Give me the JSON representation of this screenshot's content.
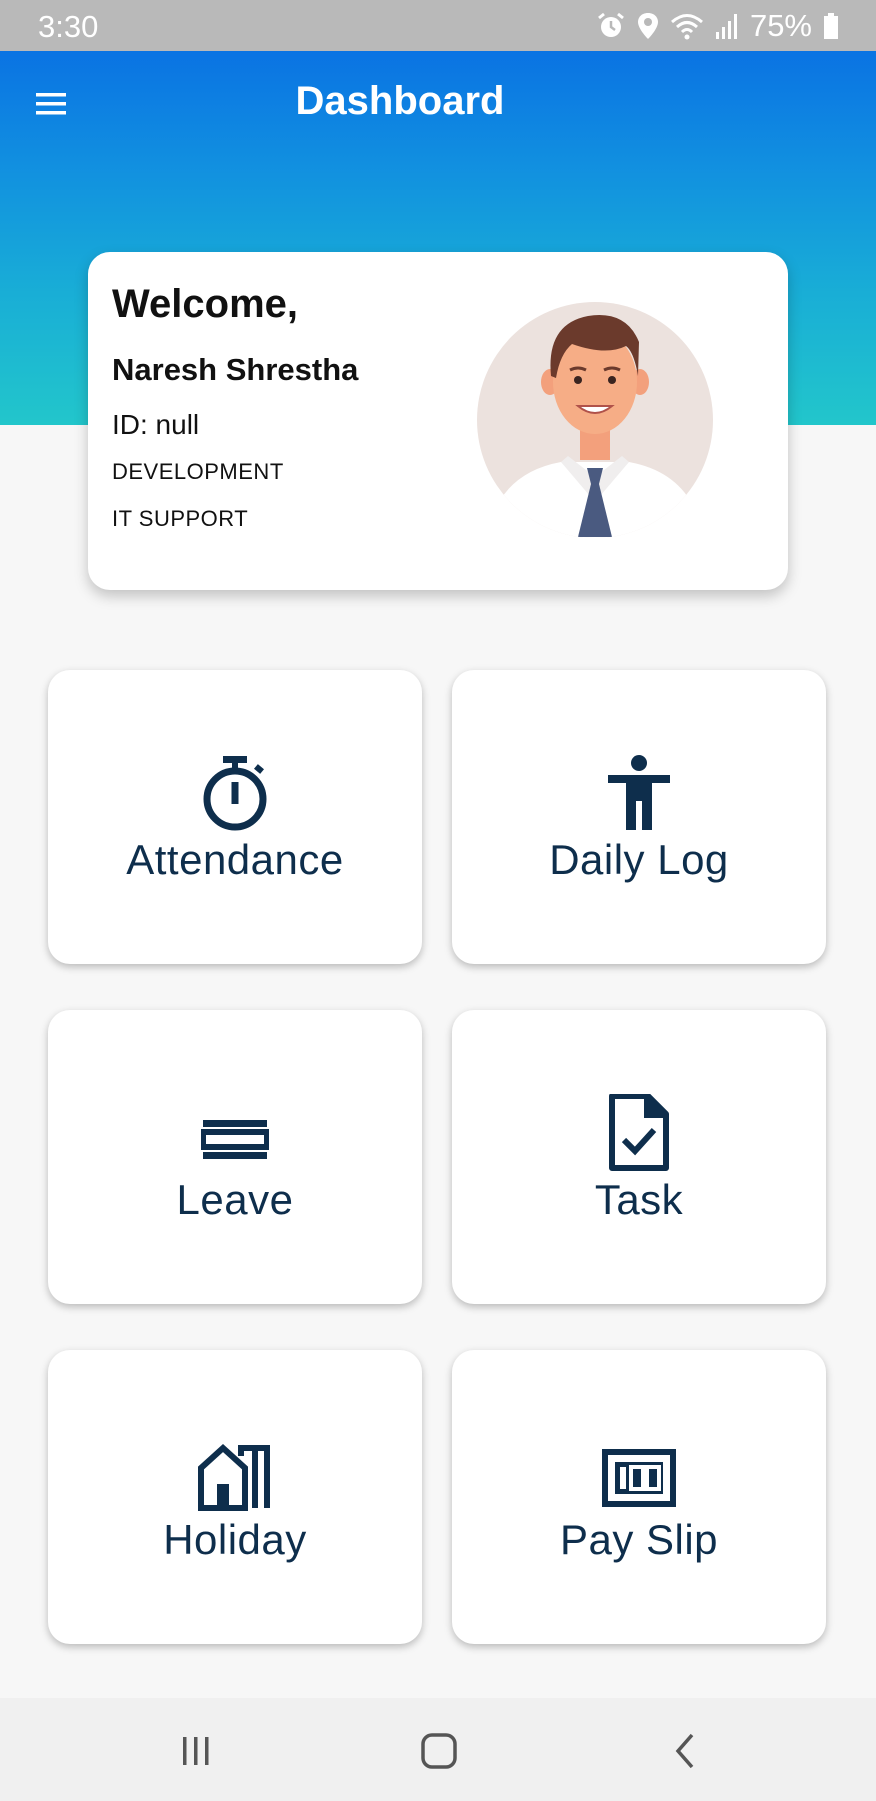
{
  "status_bar": {
    "time": "3:30",
    "battery": "75%",
    "icons": [
      "alarm-icon",
      "location-icon",
      "wifi-icon",
      "signal-icon",
      "battery-icon"
    ]
  },
  "header": {
    "title": "Dashboard",
    "menu_icon": "hamburger-menu-icon",
    "gradient": [
      "#0a73e3",
      "#22c6cb"
    ]
  },
  "profile": {
    "welcome": "Welcome,",
    "name": "Naresh Shrestha",
    "id_line": "ID: null",
    "department": "DEVELOPMENT",
    "role": "IT SUPPORT",
    "avatar_icon": "male-employee-avatar"
  },
  "tiles": [
    {
      "label": "Attendance",
      "icon": "stopwatch-icon"
    },
    {
      "label": "Daily Log",
      "icon": "accessibility-person-icon"
    },
    {
      "label": "Leave",
      "icon": "stacked-lines-icon"
    },
    {
      "label": "Task",
      "icon": "document-check-icon"
    },
    {
      "label": "Holiday",
      "icon": "houses-icon"
    },
    {
      "label": "Pay Slip",
      "icon": "banknote-100-icon"
    }
  ],
  "nav_bar": {
    "icons": [
      "recent-apps-icon",
      "home-icon",
      "back-icon"
    ]
  },
  "colors": {
    "tile_text": "#0e2e4c",
    "page_background": "#f7f7f7",
    "status_bar": "#b9b9b9"
  }
}
